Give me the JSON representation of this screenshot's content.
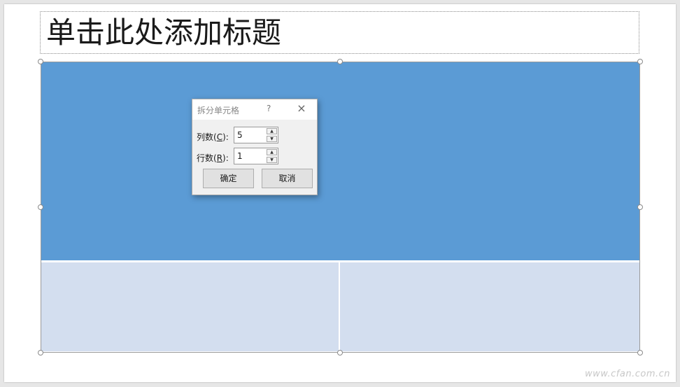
{
  "slide": {
    "title_placeholder": "单击此处添加标题"
  },
  "table": {
    "header_color": "#5b9bd5",
    "body_color": "#d3deef"
  },
  "dialog": {
    "title": "拆分单元格",
    "help_symbol": "?",
    "close_symbol": "×",
    "columns": {
      "label": "列数",
      "accelerator": "C",
      "value": "5"
    },
    "rows": {
      "label": "行数",
      "accelerator": "R",
      "value": "1"
    },
    "ok_label": "确定",
    "cancel_label": "取消"
  },
  "watermark": "www.cfan.com.cn"
}
